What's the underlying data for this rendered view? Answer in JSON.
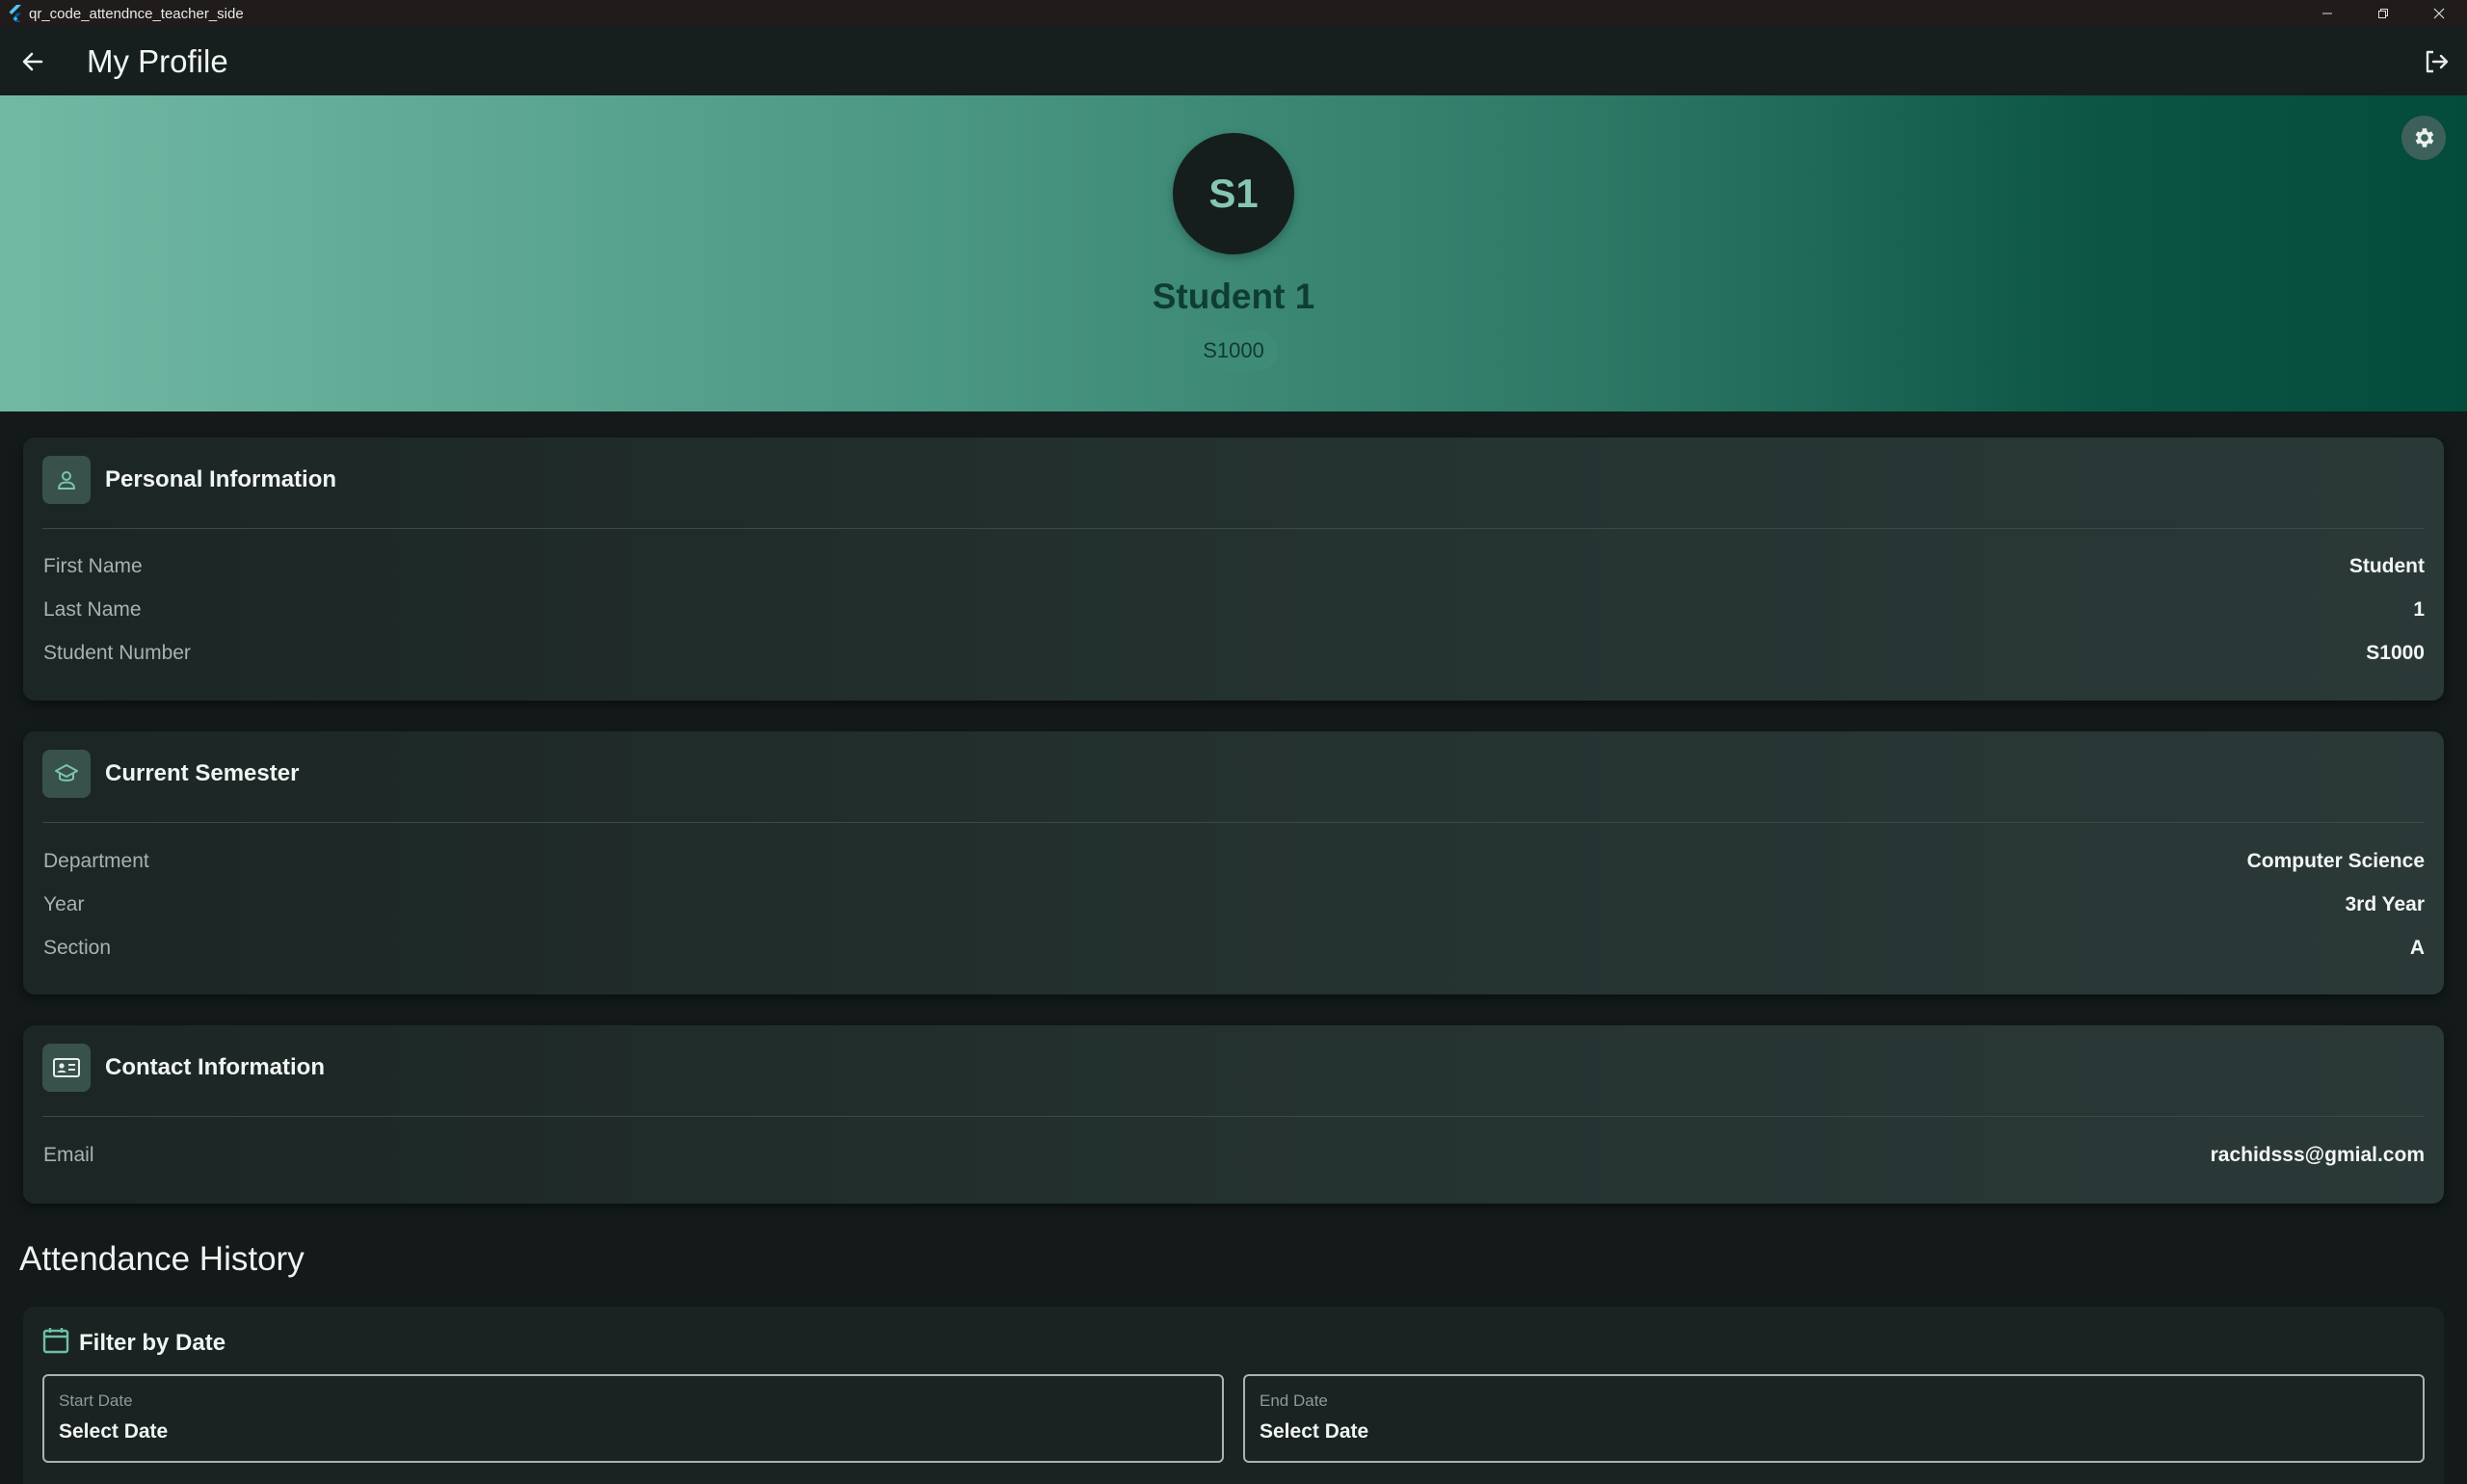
{
  "window": {
    "title": "qr_code_attendnce_teacher_side"
  },
  "appbar": {
    "title": "My Profile"
  },
  "profile": {
    "initials": "S1",
    "name": "Student 1",
    "student_id": "S1000"
  },
  "personal_info": {
    "title": "Personal Information",
    "rows": [
      {
        "label": "First Name",
        "value": "Student"
      },
      {
        "label": "Last Name",
        "value": "1"
      },
      {
        "label": "Student Number",
        "value": "S1000"
      }
    ]
  },
  "semester": {
    "title": "Current Semester",
    "rows": [
      {
        "label": "Department",
        "value": "Computer Science"
      },
      {
        "label": "Year",
        "value": "3rd Year"
      },
      {
        "label": "Section",
        "value": "A"
      }
    ]
  },
  "contact": {
    "title": "Contact Information",
    "rows": [
      {
        "label": "Email",
        "value": "rachidsss@gmial.com"
      }
    ]
  },
  "attendance": {
    "heading": "Attendance History",
    "filter_title": "Filter by Date",
    "start_label": "Start Date",
    "start_value": "Select Date",
    "end_label": "End Date",
    "end_value": "Select Date"
  },
  "colors": {
    "accent": "#72b9a4",
    "banner_dark": "#034b3b",
    "background": "#131a19"
  },
  "icons": {
    "back": "arrow-left-icon",
    "logout": "logout-icon",
    "settings": "gear-icon",
    "personal": "person-icon",
    "semester": "school-icon",
    "contact": "contact-card-icon",
    "filter": "calendar-icon"
  }
}
